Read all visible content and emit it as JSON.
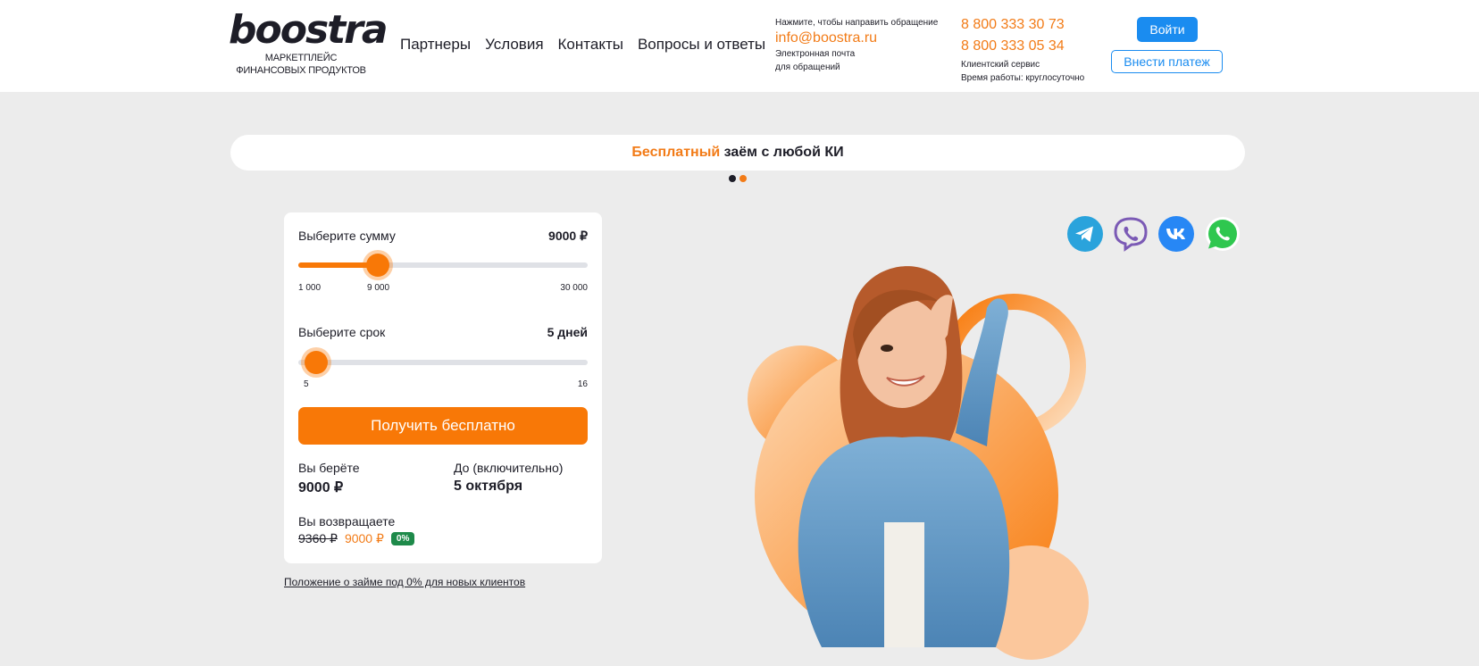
{
  "header": {
    "logo_text": "boostra",
    "logo_subtitle_1": "МАРКЕТПЛЕЙС",
    "logo_subtitle_2": "ФИНАНСОВЫХ ПРОДУКТОВ",
    "nav": [
      "Партнеры",
      "Условия",
      "Контакты",
      "Вопросы и ответы"
    ],
    "email_hint": "Нажмите, чтобы направить обращение",
    "email": "info@boostra.ru",
    "email_caption_1": "Электронная почта",
    "email_caption_2": "для обращений",
    "phone_1": "8 800 333 30 73",
    "phone_2": "8 800 333 05 34",
    "service_caption": "Клиентский сервис",
    "hours_caption": "Время работы: круглосуточно",
    "login_label": "Войти",
    "pay_label": "Внести платеж"
  },
  "banner": {
    "accent": "Бесплатный",
    "rest": " заём с любой КИ",
    "slides": 2,
    "active_slide": 2
  },
  "calculator": {
    "amount_label": "Выберите сумму",
    "amount_value": "9000 ₽",
    "amount_min": "1 000",
    "amount_current": "9 000",
    "amount_max": "30 000",
    "amount_fraction": 0.2759,
    "term_label": "Выберите срок",
    "term_value": "5 дней",
    "term_min": "5",
    "term_max": "16",
    "term_fraction": 0,
    "cta_label": "Получить бесплатно",
    "take_label": "Вы берёте",
    "take_value": "9000 ₽",
    "until_label": "До (включительно)",
    "until_value": "5 октября",
    "return_label": "Вы возвращаете",
    "old_price": "9360 ₽",
    "new_price": "9000 ₽",
    "rate_badge": "0%"
  },
  "terms_link": "Положение о займе под 0% для новых клиентов",
  "social": [
    "telegram-icon",
    "viber-icon",
    "vk-icon",
    "whatsapp-icon"
  ],
  "colors": {
    "accent": "#f87807",
    "link_orange": "#f27b17",
    "primary_blue": "#1a8cf0",
    "badge_green": "#1e8a4a",
    "page_bg": "#ececec"
  }
}
